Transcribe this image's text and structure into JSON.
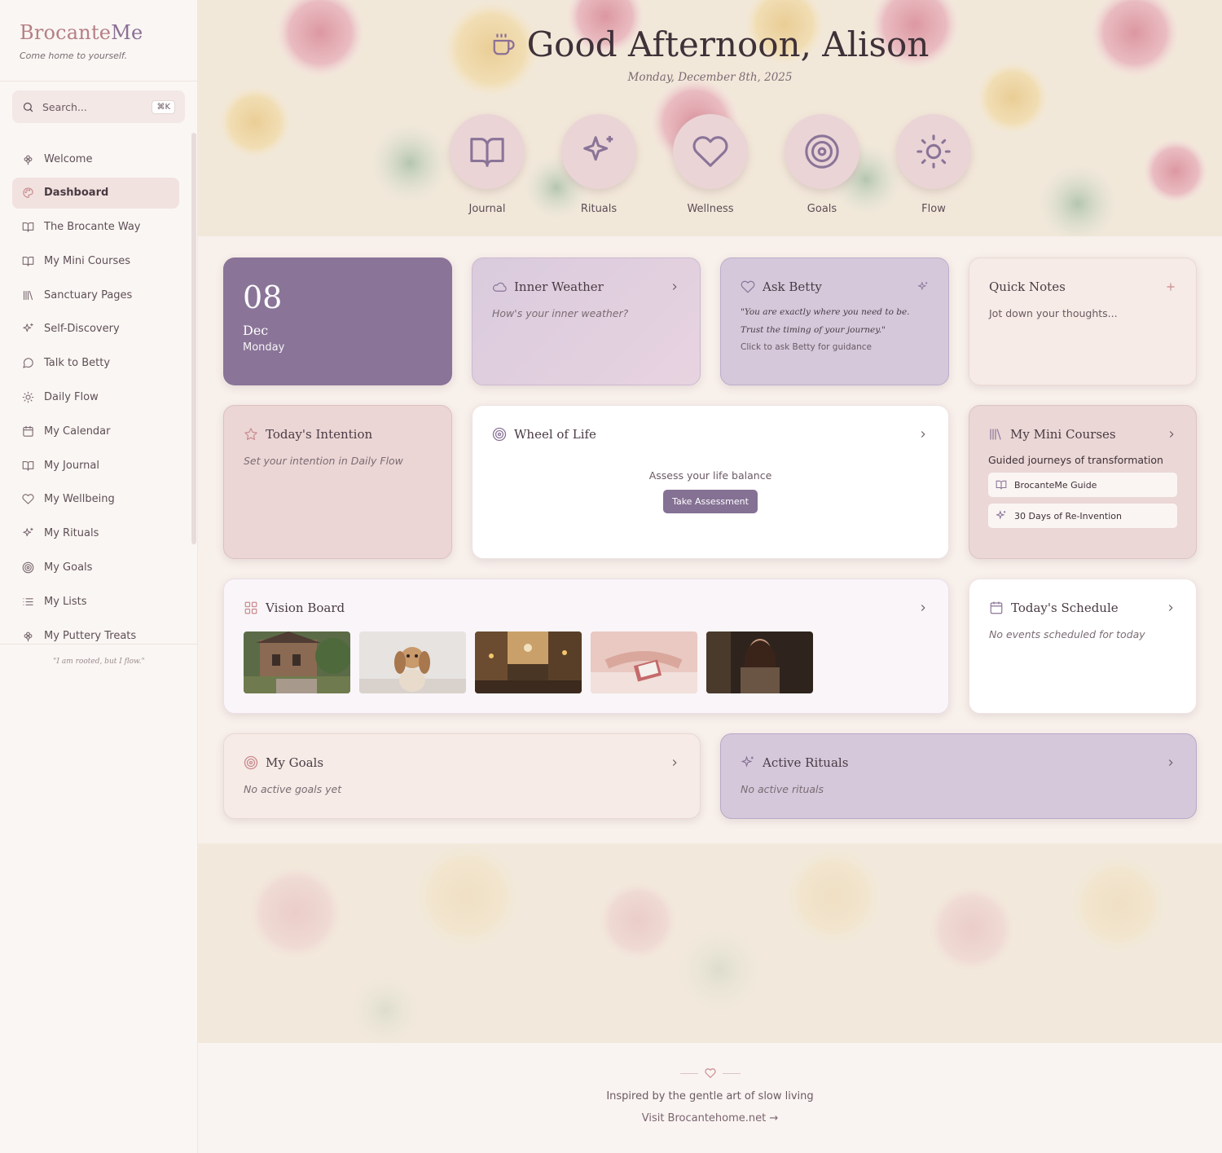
{
  "brand": {
    "name_a": "Brocante",
    "name_b": "Me",
    "tagline": "Come home to yourself."
  },
  "search": {
    "placeholder": "Search...",
    "shortcut": "⌘K"
  },
  "nav": [
    {
      "label": "Welcome",
      "icon": "flower-icon",
      "active": false
    },
    {
      "label": "Dashboard",
      "icon": "palette-icon",
      "active": true
    },
    {
      "label": "The Brocante Way",
      "icon": "book-open-icon",
      "active": false
    },
    {
      "label": "My Mini Courses",
      "icon": "book-open-icon",
      "active": false
    },
    {
      "label": "Sanctuary Pages",
      "icon": "library-icon",
      "active": false
    },
    {
      "label": "Self-Discovery",
      "icon": "sparkles-icon",
      "active": false
    },
    {
      "label": "Talk to Betty",
      "icon": "message-circle-icon",
      "active": false
    },
    {
      "label": "Daily Flow",
      "icon": "sun-icon",
      "active": false
    },
    {
      "label": "My Calendar",
      "icon": "calendar-icon",
      "active": false
    },
    {
      "label": "My Journal",
      "icon": "book-open-icon",
      "active": false
    },
    {
      "label": "My Wellbeing",
      "icon": "heart-icon",
      "active": false
    },
    {
      "label": "My Rituals",
      "icon": "sparkles-icon",
      "active": false
    },
    {
      "label": "My Goals",
      "icon": "target-icon",
      "active": false
    },
    {
      "label": "My Lists",
      "icon": "list-icon",
      "active": false
    },
    {
      "label": "My Puttery Treats",
      "icon": "flower-icon",
      "active": false
    }
  ],
  "sidebar_quote": "\"I am rooted, but I flow.\"",
  "greeting": {
    "title": "Good Afternoon, Alison",
    "date": "Monday, December 8th, 2025"
  },
  "quick_actions": [
    {
      "label": "Journal",
      "icon": "book-open-icon"
    },
    {
      "label": "Rituals",
      "icon": "sparkles-icon"
    },
    {
      "label": "Wellness",
      "icon": "heart-icon"
    },
    {
      "label": "Goals",
      "icon": "target-icon"
    },
    {
      "label": "Flow",
      "icon": "sun-icon"
    }
  ],
  "date_card": {
    "day_num": "08",
    "month": "Dec",
    "weekday": "Monday"
  },
  "inner_weather": {
    "title": "Inner Weather",
    "prompt": "How's your inner weather?"
  },
  "ask_betty": {
    "title": "Ask Betty",
    "quote": "\"You are exactly where you need to be. Trust the timing of your journey.\"",
    "hint": "Click to ask Betty for guidance"
  },
  "quick_notes": {
    "title": "Quick Notes",
    "placeholder": "Jot down your thoughts..."
  },
  "intention": {
    "title": "Today's Intention",
    "prompt": "Set your intention in Daily Flow"
  },
  "wheel": {
    "title": "Wheel of Life",
    "text": "Assess your life balance",
    "button": "Take Assessment"
  },
  "mini_courses": {
    "title": "My Mini Courses",
    "subtitle": "Guided journeys of transformation",
    "items": [
      {
        "label": "BrocanteMe Guide",
        "icon": "book-open-icon"
      },
      {
        "label": "30 Days of Re-Invention",
        "icon": "sparkles-icon"
      }
    ]
  },
  "vision_board": {
    "title": "Vision Board"
  },
  "schedule": {
    "title": "Today's Schedule",
    "empty": "No events scheduled for today"
  },
  "goals": {
    "title": "My Goals",
    "empty": "No active goals yet"
  },
  "rituals": {
    "title": "Active Rituals",
    "empty": "No active rituals"
  },
  "footer": {
    "text": "Inspired by the gentle art of slow living",
    "link": "Visit Brocantehome.net →"
  },
  "colors": {
    "accent": "#8a7498",
    "rose": "#b57f84",
    "lavender_card": "#d4c8da",
    "blush_card": "#ead7d6"
  }
}
